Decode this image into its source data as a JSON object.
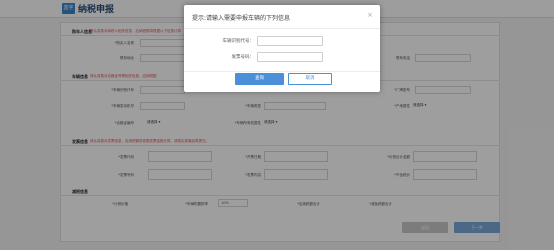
{
  "app": {
    "logo_text": "蓝字",
    "title": "纳税申报"
  },
  "sections": [
    {
      "title": "购车人信息",
      "hint": "请认真核对纳税人相关信息，应纳税额将根据以下信息计算"
    },
    {
      "title": "车辆信息",
      "hint": "请认真核对合格证号等相关信息，应纳税额"
    },
    {
      "title": "发票信息",
      "hint": "请认真核对发票信息，应纳税额将依据发票金额计算，请核实准确后再提交。"
    },
    {
      "title": "减税信息"
    }
  ],
  "fields": {
    "buyer_name": "*购买人名称",
    "buyer_addr": "联系地址",
    "buyer_phone": "联系电话",
    "vin": "*车辆识别代号",
    "plate_type": "*厂牌型号",
    "engine_no": "*车辆发动机号",
    "vehicle_kind": "*车辆类型",
    "origin": "*产地属性",
    "origin_select": "请选择",
    "cert_no": "*合格证编号",
    "cert_select": "请选择",
    "level": "*车辆所有权属性",
    "level_select": "请选择",
    "invoice_code": "*发票代码",
    "invoice_date": "*开票日期",
    "invoice_amount": "*价税合计金额",
    "invoice_no": "*发票号码",
    "invoice_tax": "*发票内容",
    "invoice_excl": "*不含税价",
    "reduction": "*计税价格",
    "tax_rate": "*车辆购置税率",
    "tax_rate_value": "10%",
    "tax_amount": "*应纳税额合计",
    "reduction_note": "*减免税额合计"
  },
  "footer": {
    "back": "返回",
    "next": "下一步"
  },
  "modal": {
    "title": "提示:请输入需要申报车辆的下列信息",
    "close": "×",
    "vin_label": "车辆识别代号：",
    "invoice_label": "发票号码：",
    "ok": "查询",
    "cancel": "取消"
  }
}
